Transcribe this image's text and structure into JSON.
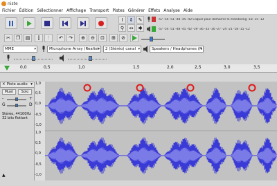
{
  "window": {
    "title": "niste"
  },
  "menu": [
    "Fichier",
    "Édition",
    "Sélectionner",
    "Affichage",
    "Transport",
    "Pistes",
    "Générer",
    "Effets",
    "Analyse",
    "Aide"
  ],
  "meters": {
    "record_scale": "-57 -54 -51 -48 -45 -42 Cliquer pour démarrer le monitoring -18 -15 -12",
    "play_scale": "-57 -54 -51 -48 -45 -42 -39 -36 -33 -30 -27 -24 -21 -18 -15 -12"
  },
  "devices": {
    "host": "MME",
    "input": "Microphone Array (Realtel",
    "channels": "2 (Stéréo) canal",
    "output": "Speakers / Headphones (R"
  },
  "ruler": {
    "ticks": [
      "0,0",
      "0,5",
      "1,0",
      "1,5",
      "2,0",
      "2,5",
      "3,0",
      "3,5"
    ]
  },
  "track": {
    "name": "Piste audio",
    "mute": "Muet",
    "solo": "Solo",
    "gain_left": "-",
    "gain_right": "+",
    "pan_left": "G",
    "pan_right": "D",
    "info_line1": "Stéréo, 44100Hz",
    "info_line2": "32 bits flottant",
    "scale": [
      "1,0",
      "0,5",
      "0,0",
      "-0,5",
      "-1,0",
      "1,0",
      "0,5",
      "0,0",
      "-0,5",
      "-1,0"
    ]
  },
  "icons": [
    "pause-icon",
    "play-icon",
    "stop-icon",
    "skip-start-icon",
    "skip-end-icon",
    "record-icon",
    "selection-tool-icon",
    "envelope-tool-icon",
    "draw-tool-icon",
    "zoom-tool-icon",
    "timeshift-tool-icon",
    "multi-tool-icon",
    "cut-icon",
    "copy-icon",
    "paste-icon",
    "trim-icon",
    "silence-icon",
    "undo-icon",
    "redo-icon",
    "zoom-in-icon",
    "zoom-out-icon",
    "fit-selection-icon",
    "fit-project-icon",
    "zoom-toggle-icon",
    "play-at-speed-icon",
    "microphone-icon",
    "speaker-icon"
  ],
  "colors": {
    "waveform": "#3a3ad6",
    "rms": "#7b7be8",
    "highlight": "#e01818",
    "play": "#3aa63a",
    "record": "#d61f1f"
  }
}
